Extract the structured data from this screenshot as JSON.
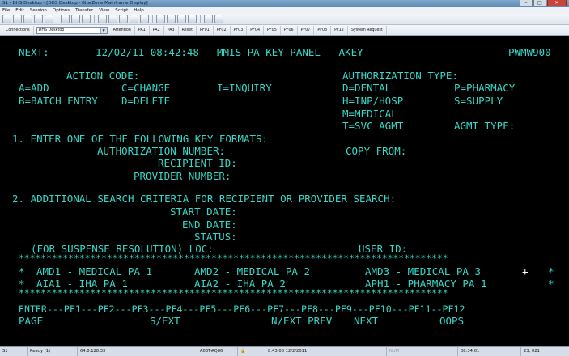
{
  "window": {
    "title": "S1 - DHS Desktop - [DHS Desktop - BlueZone Mainframe Display]",
    "minimize": "–",
    "maximize": "□",
    "close": "✕"
  },
  "menu": [
    "File",
    "Edit",
    "Session",
    "Options",
    "Transfer",
    "View",
    "Script",
    "Help"
  ],
  "toolbar2": {
    "connections": "Connections",
    "session": "DHS Desktop",
    "keys": [
      "Attention",
      "PA1",
      "PA2",
      "PA3",
      "Reset",
      "PF01",
      "PF02",
      "PF03",
      "PF04",
      "PF05",
      "PF06",
      "PF07",
      "PF08",
      "PF12",
      "System Request"
    ]
  },
  "screen": {
    "next_label": "NEXT:",
    "datetime": "12/02/11 08:42:48",
    "title": "MMIS PA KEY PANEL - AKEY",
    "panel_id": "PWMW900",
    "action_code_label": "ACTION CODE:",
    "auth_type_label": "AUTHORIZATION TYPE:",
    "add": "A=ADD",
    "change": "C=CHANGE",
    "inquiry": "I=INQUIRY",
    "dental": "D=DENTAL",
    "pharmacy": "P=PHARMACY",
    "batch": "B=BATCH ENTRY",
    "delete": "D=DELETE",
    "inphosp": "H=INP/HOSP",
    "supply": "S=SUPPLY",
    "medical": "M=MEDICAL",
    "svcagmt": "T=SVC AGMT",
    "agmt_type": "AGMT TYPE:",
    "step1": "1. ENTER ONE OF THE FOLLOWING KEY FORMATS:",
    "auth_number": "AUTHORIZATION NUMBER:",
    "copy_from": "COPY FROM:",
    "recipient_id": "RECIPIENT ID:",
    "provider_number": "PROVIDER NUMBER:",
    "step2": "2. ADDITIONAL SEARCH CRITERIA FOR RECIPIENT OR PROVIDER SEARCH:",
    "start_date": "START DATE:",
    "end_date": "END DATE:",
    "status": "STATUS:",
    "suspense_loc": "(FOR SUSPENSE RESOLUTION) LOC:",
    "user_id": "USER ID:",
    "stars": "******************************************************************************",
    "star": "*",
    "amd1": "AMD1 - MEDICAL PA 1",
    "amd2": "AMD2 - MEDICAL PA 2",
    "amd3": "AMD3 - MEDICAL PA 3",
    "plus": "+",
    "aia1": "AIA1 - IHA PA 1",
    "aia2": "AIA2 - IHA PA 2",
    "aph1": "APH1 - PHARMACY PA 1",
    "pfkeys": "ENTER---PF1---PF2---PF3---PF4---PF5---PF6---PF7---PF8---PF9---PF10---PF11--PF12",
    "page": "PAGE",
    "sext": "S/EXT",
    "next_prev": "N/EXT PREV",
    "next_key": "NEXT",
    "oops": "OOPS"
  },
  "statusbar": {
    "session": "S1",
    "ready": "Ready (1)",
    "host": "64.8.128.33",
    "device": "A03T#Q86",
    "timestamp": "8:43:08 12/2/2011",
    "num": "NUM",
    "clock": "08:34:01",
    "cursor": "23, 021"
  },
  "colors": {
    "screen_bg": "#000000",
    "screen_text": "#35d8c8",
    "cursor_plus": "#ffffff"
  }
}
